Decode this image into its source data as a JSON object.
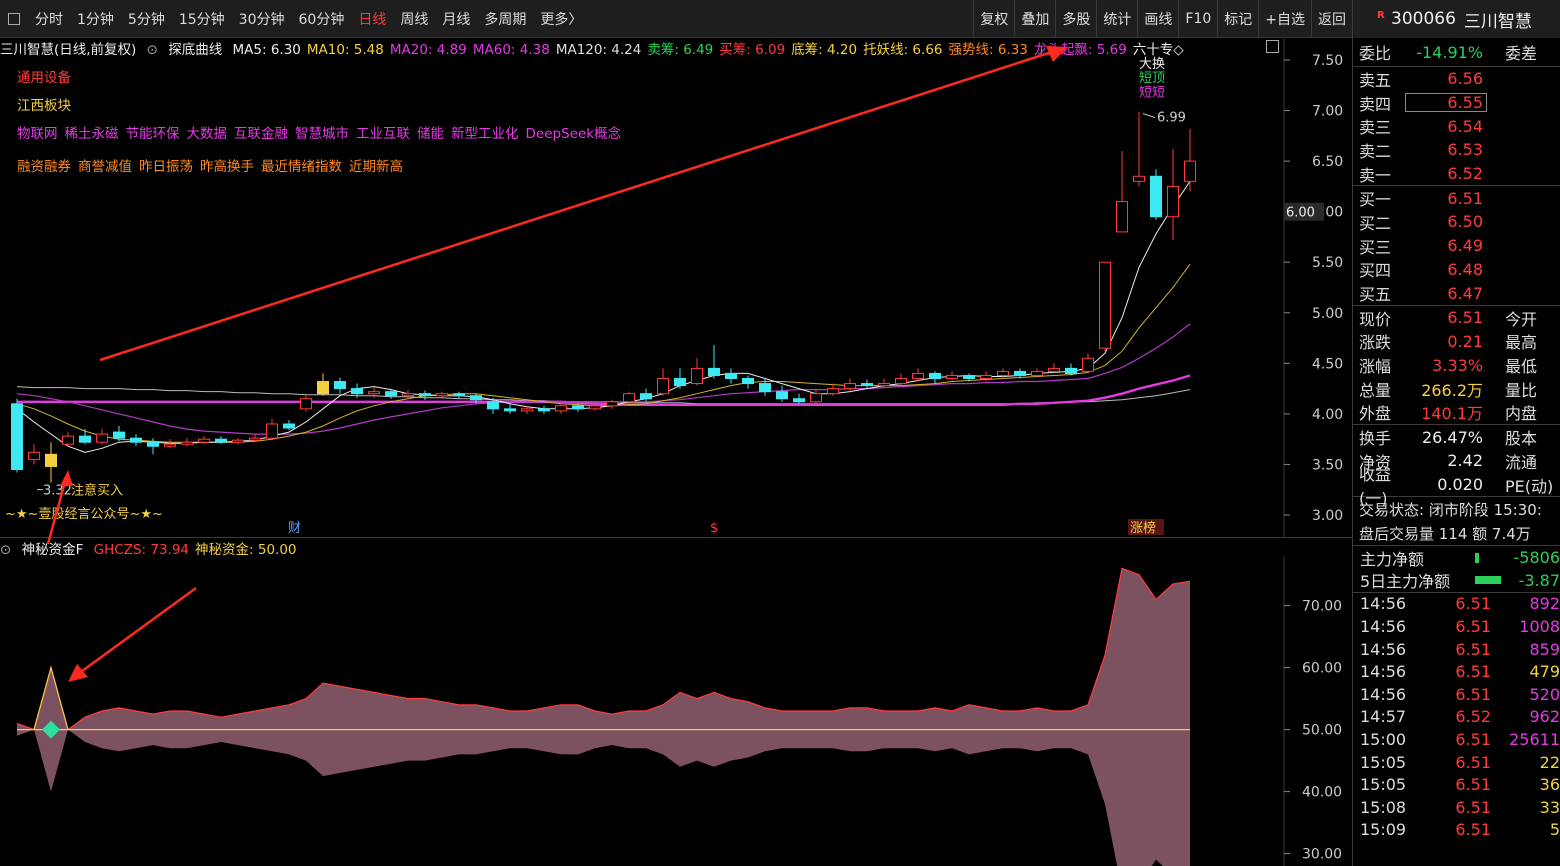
{
  "toolbar": {
    "periods": [
      "分时",
      "1分钟",
      "5分钟",
      "15分钟",
      "30分钟",
      "60分钟",
      "日线",
      "周线",
      "月线",
      "多周期",
      "更多〉"
    ],
    "active_period": "日线",
    "right_buttons": [
      "复权",
      "叠加",
      "多股",
      "统计",
      "画线",
      "F10",
      "标记",
      "+自选",
      "返回"
    ]
  },
  "chart_header": {
    "stock_title": "三川智慧(日线,前复权)",
    "indicator_name": "探底曲线",
    "items": [
      {
        "text": "MA5: 6.30",
        "color": "#eeeeee"
      },
      {
        "text": "MA10: 5.48",
        "color": "#f5d040"
      },
      {
        "text": "MA20: 4.89",
        "color": "#e23be3"
      },
      {
        "text": "MA60: 4.38",
        "color": "#e23be3"
      },
      {
        "text": "MA120: 4.24",
        "color": "#dddddd"
      },
      {
        "text": "卖筹: 6.49",
        "color": "#2bd05a"
      },
      {
        "text": "买筹: 6.09",
        "color": "#ff3b3b"
      },
      {
        "text": "底筹: 4.20",
        "color": "#f5d040"
      },
      {
        "text": "托妖线: 6.66",
        "color": "#f5d040"
      },
      {
        "text": "强势线: 6.33",
        "color": "#ff8a1f"
      },
      {
        "text": "龙头起飘: 5.69",
        "color": "#e23be3"
      },
      {
        "text": "六十专◇",
        "color": "#eeeeee"
      }
    ]
  },
  "tags": {
    "industry": "通用设备",
    "region": "江西板块",
    "concepts": [
      "物联网",
      "稀土永磁",
      "节能环保",
      "大数据",
      "互联金融",
      "智慧城市",
      "工业互联",
      "储能",
      "新型工业化",
      "DeepSeek概念"
    ],
    "features": [
      "融资融券",
      "商誉减值",
      "昨日振荡",
      "昨高换手",
      "最近情绪指数",
      "近期新高"
    ]
  },
  "annotations": {
    "low_label": "3.32",
    "high_label": "6.99",
    "buy_note": "注意买入",
    "watermark": "~★~壹股经言公众号~★~",
    "event_cai": "财",
    "event_s": "$",
    "event_zhangbang": "涨榜",
    "top_labels": [
      "大换",
      "短顶",
      "短短"
    ],
    "price_tag": "6.00"
  },
  "sub_header": {
    "name": "神秘资金F",
    "items": [
      {
        "text": "GHCZS: 73.94",
        "color": "#ff3b3b"
      },
      {
        "text": "神秘资金: 50.00",
        "color": "#f5d040"
      }
    ]
  },
  "main_axis": [
    "7.50",
    "7.00",
    "6.50",
    "6.00",
    "5.50",
    "5.00",
    "4.50",
    "4.00",
    "3.50",
    "3.00"
  ],
  "sub_axis": [
    "70.00",
    "60.00",
    "50.00",
    "40.00",
    "30.00"
  ],
  "quote": {
    "code": "300066",
    "name": "三川智慧",
    "r_mark": "R",
    "weibi_label": "委比",
    "weibi_value": "-14.91%",
    "weicha_label": "委差",
    "asks": [
      {
        "label": "卖五",
        "price": "6.56"
      },
      {
        "label": "卖四",
        "price": "6.55"
      },
      {
        "label": "卖三",
        "price": "6.54"
      },
      {
        "label": "卖二",
        "price": "6.53"
      },
      {
        "label": "卖一",
        "price": "6.52"
      }
    ],
    "bids": [
      {
        "label": "买一",
        "price": "6.51"
      },
      {
        "label": "买二",
        "price": "6.50"
      },
      {
        "label": "买三",
        "price": "6.49"
      },
      {
        "label": "买四",
        "price": "6.48"
      },
      {
        "label": "买五",
        "price": "6.47"
      }
    ],
    "stats": [
      {
        "label": "现价",
        "value": "6.51",
        "color": "#ff3b3b",
        "label2": "今开"
      },
      {
        "label": "涨跌",
        "value": "0.21",
        "color": "#ff3b3b",
        "label2": "最高"
      },
      {
        "label": "涨幅",
        "value": "3.33%",
        "color": "#ff3b3b",
        "label2": "最低"
      },
      {
        "label": "总量",
        "value": "266.2万",
        "color": "#f5d040",
        "label2": "量比"
      },
      {
        "label": "外盘",
        "value": "140.1万",
        "color": "#ff3b3b",
        "label2": "内盘"
      }
    ],
    "stats2": [
      {
        "label": "换手",
        "value": "26.47%",
        "color": "#eeeeee",
        "label2": "股本"
      },
      {
        "label": "净资",
        "value": "2.42",
        "color": "#eeeeee",
        "label2": "流通"
      },
      {
        "label": "收益(一)",
        "value": "0.020",
        "color": "#eeeeee",
        "label2": "PE(动)"
      }
    ],
    "trade_status": "交易状态: 闭市阶段 15:30:",
    "after_hours": "盘后交易量 114 额 7.4万",
    "main_net_label": "主力净额",
    "main_net_value": "-5806",
    "five_day_label": "5日主力净额",
    "five_day_value": "-3.87",
    "ticks": [
      {
        "time": "14:56",
        "price": "6.51",
        "vol": "892",
        "color": "#e23be3"
      },
      {
        "time": "14:56",
        "price": "6.51",
        "vol": "1008",
        "color": "#e23be3"
      },
      {
        "time": "14:56",
        "price": "6.51",
        "vol": "859",
        "color": "#e23be3"
      },
      {
        "time": "14:56",
        "price": "6.51",
        "vol": "479",
        "color": "#f5d040"
      },
      {
        "time": "14:56",
        "price": "6.51",
        "vol": "520",
        "color": "#e23be3"
      },
      {
        "time": "14:57",
        "price": "6.52",
        "vol": "962",
        "color": "#e23be3"
      },
      {
        "time": "15:00",
        "price": "6.51",
        "vol": "25611",
        "color": "#e23be3"
      },
      {
        "time": "15:05",
        "price": "6.51",
        "vol": "22",
        "color": "#f5d040"
      },
      {
        "time": "15:05",
        "price": "6.51",
        "vol": "36",
        "color": "#f5d040"
      },
      {
        "time": "15:08",
        "price": "6.51",
        "vol": "33",
        "color": "#f5d040"
      },
      {
        "time": "15:09",
        "price": "6.51",
        "vol": "5",
        "color": "#f5d040"
      }
    ]
  },
  "chart_data": {
    "type": "candlestick",
    "price_range": [
      3.0,
      7.5
    ],
    "sub_range": [
      28,
      78
    ],
    "candles": [
      [
        4.1,
        3.45,
        4.15,
        3.42
      ],
      [
        3.55,
        3.62,
        3.7,
        3.5
      ],
      [
        3.6,
        3.48,
        3.72,
        3.32
      ],
      [
        3.7,
        3.78,
        3.82,
        3.68
      ],
      [
        3.78,
        3.72,
        3.85,
        3.7
      ],
      [
        3.72,
        3.8,
        3.85,
        3.7
      ],
      [
        3.82,
        3.76,
        3.88,
        3.73
      ],
      [
        3.76,
        3.72,
        3.8,
        3.68
      ],
      [
        3.72,
        3.68,
        3.76,
        3.6
      ],
      [
        3.68,
        3.7,
        3.75,
        3.66
      ],
      [
        3.7,
        3.72,
        3.76,
        3.68
      ],
      [
        3.72,
        3.75,
        3.78,
        3.7
      ],
      [
        3.75,
        3.72,
        3.78,
        3.7
      ],
      [
        3.72,
        3.74,
        3.76,
        3.7
      ],
      [
        3.74,
        3.76,
        3.8,
        3.72
      ],
      [
        3.76,
        3.9,
        3.95,
        3.74
      ],
      [
        3.9,
        3.86,
        3.94,
        3.84
      ],
      [
        4.05,
        4.15,
        4.2,
        4.02
      ],
      [
        4.2,
        4.32,
        4.4,
        4.18
      ],
      [
        4.32,
        4.25,
        4.36,
        4.2
      ],
      [
        4.25,
        4.2,
        4.3,
        4.16
      ],
      [
        4.2,
        4.22,
        4.26,
        4.16
      ],
      [
        4.22,
        4.18,
        4.25,
        4.15
      ],
      [
        4.18,
        4.2,
        4.24,
        4.15
      ],
      [
        4.2,
        4.18,
        4.23,
        4.14
      ],
      [
        4.18,
        4.2,
        4.22,
        4.15
      ],
      [
        4.2,
        4.18,
        4.22,
        4.15
      ],
      [
        4.18,
        4.14,
        4.2,
        4.1
      ],
      [
        4.12,
        4.05,
        4.16,
        4.0
      ],
      [
        4.05,
        4.03,
        4.1,
        4.0
      ],
      [
        4.03,
        4.05,
        4.08,
        4.0
      ],
      [
        4.05,
        4.03,
        4.08,
        4.0
      ],
      [
        4.03,
        4.08,
        4.1,
        4.0
      ],
      [
        4.08,
        4.05,
        4.1,
        4.02
      ],
      [
        4.05,
        4.08,
        4.12,
        4.03
      ],
      [
        4.08,
        4.12,
        4.14,
        4.05
      ],
      [
        4.12,
        4.2,
        4.22,
        4.1
      ],
      [
        4.2,
        4.15,
        4.25,
        4.12
      ],
      [
        4.2,
        4.35,
        4.45,
        4.18
      ],
      [
        4.35,
        4.28,
        4.45,
        4.25
      ],
      [
        4.3,
        4.45,
        4.55,
        4.28
      ],
      [
        4.45,
        4.38,
        4.68,
        4.35
      ],
      [
        4.4,
        4.35,
        4.45,
        4.3
      ],
      [
        4.35,
        4.3,
        4.38,
        4.25
      ],
      [
        4.3,
        4.22,
        4.35,
        4.18
      ],
      [
        4.22,
        4.15,
        4.28,
        4.12
      ],
      [
        4.15,
        4.12,
        4.2,
        4.1
      ],
      [
        4.12,
        4.2,
        4.24,
        4.1
      ],
      [
        4.2,
        4.25,
        4.3,
        4.18
      ],
      [
        4.25,
        4.3,
        4.35,
        4.22
      ],
      [
        4.3,
        4.28,
        4.34,
        4.25
      ],
      [
        4.28,
        4.3,
        4.35,
        4.26
      ],
      [
        4.3,
        4.35,
        4.4,
        4.28
      ],
      [
        4.35,
        4.4,
        4.45,
        4.32
      ],
      [
        4.4,
        4.35,
        4.42,
        4.3
      ],
      [
        4.35,
        4.38,
        4.42,
        4.33
      ],
      [
        4.38,
        4.35,
        4.4,
        4.32
      ],
      [
        4.35,
        4.38,
        4.42,
        4.32
      ],
      [
        4.38,
        4.42,
        4.45,
        4.35
      ],
      [
        4.42,
        4.38,
        4.45,
        4.35
      ],
      [
        4.38,
        4.42,
        4.45,
        4.36
      ],
      [
        4.42,
        4.45,
        4.5,
        4.4
      ],
      [
        4.45,
        4.4,
        4.5,
        4.38
      ],
      [
        4.42,
        4.55,
        4.6,
        4.4
      ],
      [
        4.65,
        5.5,
        5.5,
        4.62
      ],
      [
        5.8,
        6.1,
        6.6,
        5.8
      ],
      [
        6.3,
        6.35,
        6.99,
        6.25
      ],
      [
        6.35,
        5.95,
        6.42,
        5.92
      ],
      [
        5.95,
        6.25,
        6.62,
        5.72
      ],
      [
        6.3,
        6.5,
        6.82,
        6.2
      ]
    ],
    "ma5": [
      4.05,
      3.92,
      3.8,
      3.68,
      3.62,
      3.66,
      3.72,
      3.73,
      3.72,
      3.71,
      3.71,
      3.72,
      3.72,
      3.73,
      3.74,
      3.78,
      3.82,
      3.92,
      4.05,
      4.18,
      4.25,
      4.27,
      4.24,
      4.2,
      4.19,
      4.18,
      4.18,
      4.17,
      4.14,
      4.1,
      4.07,
      4.05,
      4.05,
      4.05,
      4.06,
      4.08,
      4.12,
      4.15,
      4.2,
      4.28,
      4.33,
      4.38,
      4.4,
      4.4,
      4.35,
      4.3,
      4.25,
      4.2,
      4.2,
      4.22,
      4.25,
      4.28,
      4.3,
      4.33,
      4.36,
      4.37,
      4.38,
      4.37,
      4.37,
      4.38,
      4.4,
      4.41,
      4.42,
      4.45,
      4.6,
      4.95,
      5.45,
      5.78,
      6.05,
      6.3
    ],
    "ma10": [
      4.1,
      4.05,
      3.98,
      3.9,
      3.83,
      3.78,
      3.75,
      3.74,
      3.73,
      3.72,
      3.72,
      3.72,
      3.72,
      3.72,
      3.73,
      3.75,
      3.78,
      3.82,
      3.88,
      3.96,
      4.03,
      4.08,
      4.12,
      4.15,
      4.18,
      4.19,
      4.2,
      4.2,
      4.18,
      4.16,
      4.14,
      4.12,
      4.1,
      4.09,
      4.08,
      4.08,
      4.09,
      4.1,
      4.13,
      4.16,
      4.2,
      4.24,
      4.28,
      4.31,
      4.32,
      4.32,
      4.31,
      4.3,
      4.29,
      4.28,
      4.28,
      4.28,
      4.28,
      4.29,
      4.3,
      4.32,
      4.33,
      4.34,
      4.35,
      4.36,
      4.37,
      4.38,
      4.39,
      4.41,
      4.48,
      4.62,
      4.85,
      5.05,
      5.25,
      5.48
    ],
    "ma20": [
      4.2,
      4.18,
      4.15,
      4.12,
      4.08,
      4.04,
      4.0,
      3.96,
      3.92,
      3.88,
      3.85,
      3.83,
      3.82,
      3.81,
      3.8,
      3.8,
      3.8,
      3.81,
      3.83,
      3.86,
      3.9,
      3.94,
      3.97,
      4.0,
      4.03,
      4.06,
      4.08,
      4.1,
      4.11,
      4.12,
      4.12,
      4.12,
      4.12,
      4.12,
      4.12,
      4.12,
      4.12,
      4.12,
      4.13,
      4.14,
      4.16,
      4.18,
      4.2,
      4.21,
      4.22,
      4.23,
      4.24,
      4.24,
      4.24,
      4.25,
      4.25,
      4.26,
      4.27,
      4.28,
      4.29,
      4.3,
      4.3,
      4.31,
      4.31,
      4.32,
      4.32,
      4.33,
      4.34,
      4.35,
      4.4,
      4.46,
      4.55,
      4.65,
      4.76,
      4.89
    ],
    "ma60": [
      4.12,
      4.12,
      4.12,
      4.12,
      4.12,
      4.12,
      4.12,
      4.12,
      4.12,
      4.12,
      4.12,
      4.12,
      4.12,
      4.12,
      4.12,
      4.12,
      4.12,
      4.12,
      4.12,
      4.12,
      4.12,
      4.12,
      4.12,
      4.12,
      4.12,
      4.12,
      4.12,
      4.12,
      4.12,
      4.12,
      4.12,
      4.12,
      4.12,
      4.11,
      4.1,
      4.1,
      4.09,
      4.09,
      4.09,
      4.09,
      4.09,
      4.09,
      4.09,
      4.09,
      4.09,
      4.09,
      4.09,
      4.09,
      4.09,
      4.09,
      4.09,
      4.09,
      4.09,
      4.09,
      4.09,
      4.09,
      4.09,
      4.09,
      4.09,
      4.1,
      4.1,
      4.11,
      4.12,
      4.13,
      4.16,
      4.2,
      4.25,
      4.29,
      4.33,
      4.38
    ],
    "ma120": [
      4.27,
      4.26,
      4.26,
      4.26,
      4.25,
      4.25,
      4.25,
      4.24,
      4.24,
      4.23,
      4.23,
      4.22,
      4.22,
      4.21,
      4.21,
      4.2,
      4.2,
      4.19,
      4.19,
      4.19,
      4.18,
      4.18,
      4.17,
      4.17,
      4.16,
      4.16,
      4.15,
      4.15,
      4.14,
      4.14,
      4.13,
      4.13,
      4.12,
      4.12,
      4.12,
      4.12,
      4.11,
      4.11,
      4.11,
      4.11,
      4.1,
      4.1,
      4.1,
      4.1,
      4.1,
      4.1,
      4.1,
      4.1,
      4.1,
      4.1,
      4.1,
      4.1,
      4.1,
      4.1,
      4.1,
      4.1,
      4.1,
      4.1,
      4.1,
      4.1,
      4.11,
      4.11,
      4.12,
      4.12,
      4.13,
      4.14,
      4.16,
      4.18,
      4.21,
      4.24
    ],
    "ghczs": [
      51,
      50,
      60,
      50,
      52,
      53,
      53.5,
      53,
      52.5,
      53,
      53,
      52.5,
      52,
      52.5,
      53,
      53.5,
      54,
      55,
      57.5,
      57,
      56.5,
      56,
      55.5,
      55,
      55,
      54.5,
      54,
      54,
      53.5,
      53,
      53,
      53.5,
      54,
      54,
      53,
      52.5,
      53,
      53,
      54,
      56,
      55,
      56,
      55,
      54.5,
      53.5,
      53,
      53,
      53,
      53,
      53.5,
      53.5,
      53,
      53,
      53,
      53.5,
      53,
      54,
      53.5,
      53,
      53,
      53.5,
      53,
      53,
      54,
      62,
      76,
      75,
      71,
      73.5,
      73.9
    ],
    "mystery": 50
  }
}
